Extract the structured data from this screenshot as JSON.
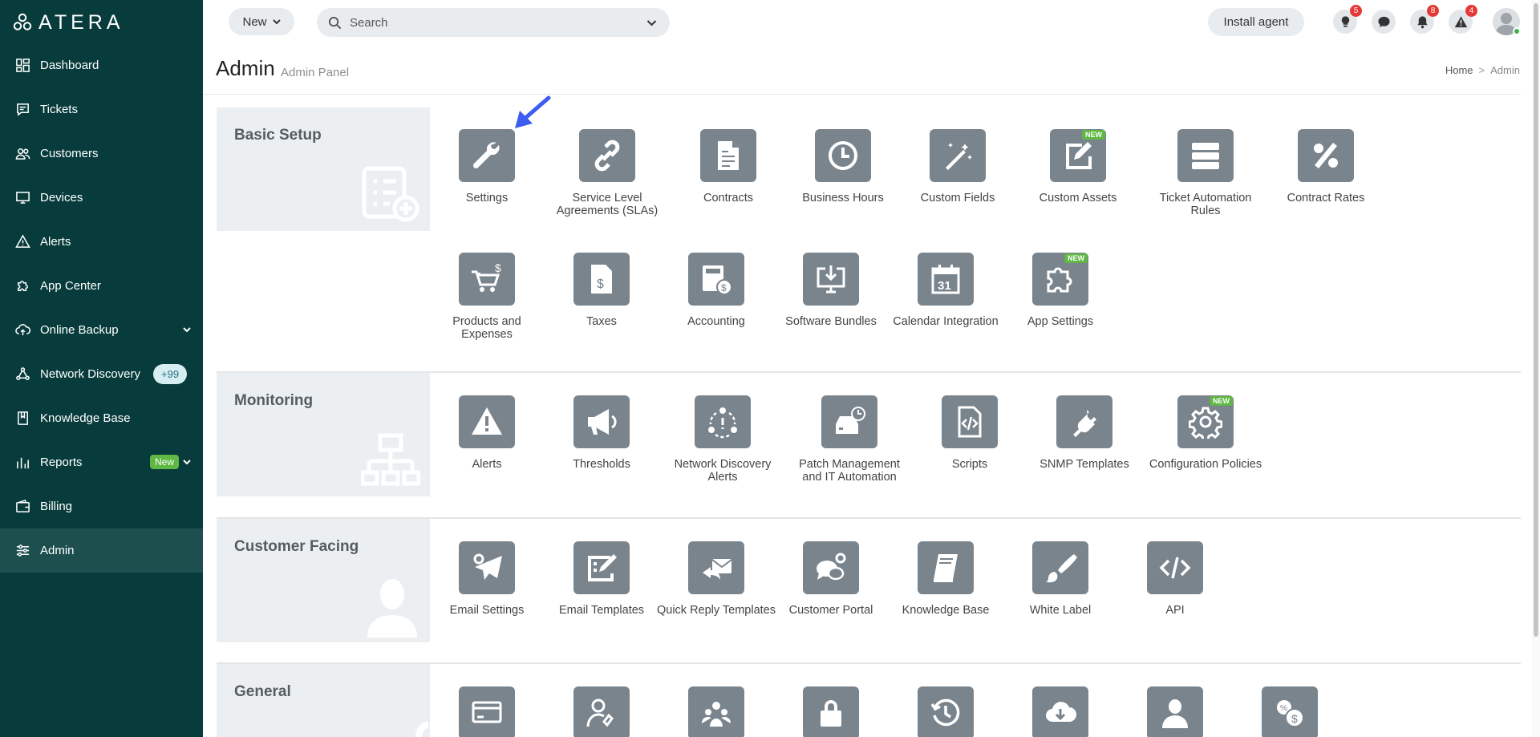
{
  "app": {
    "logo_text": "ATERA"
  },
  "sidebar": {
    "items": [
      {
        "label": "Dashboard",
        "icon": "dashboard-icon"
      },
      {
        "label": "Tickets",
        "icon": "ticket-icon"
      },
      {
        "label": "Customers",
        "icon": "customers-icon"
      },
      {
        "label": "Devices",
        "icon": "monitor-icon"
      },
      {
        "label": "Alerts",
        "icon": "alert-triangle-icon"
      },
      {
        "label": "App Center",
        "icon": "puzzle-icon"
      },
      {
        "label": "Online Backup",
        "icon": "cloud-upload-icon"
      },
      {
        "label": "Network Discovery",
        "icon": "network-icon",
        "count": "+99"
      },
      {
        "label": "Knowledge Base",
        "icon": "book-icon"
      },
      {
        "label": "Reports",
        "icon": "bar-chart-icon",
        "tag": "New"
      },
      {
        "label": "Billing",
        "icon": "wallet-icon"
      },
      {
        "label": "Admin",
        "icon": "sliders-icon",
        "active": true
      }
    ]
  },
  "topbar": {
    "new_label": "New",
    "search_placeholder": "Search",
    "install_label": "Install agent",
    "badges": {
      "tips": "5",
      "notifications": "8",
      "alerts": "4"
    }
  },
  "header": {
    "title": "Admin",
    "subtitle": "Admin Panel",
    "breadcrumb": {
      "home": "Home",
      "sep": ">",
      "current": "Admin"
    }
  },
  "sections": {
    "basic": {
      "title": "Basic Setup",
      "tiles": [
        {
          "label": "Settings"
        },
        {
          "label": "Service Level Agreements (SLAs)"
        },
        {
          "label": "Contracts"
        },
        {
          "label": "Business Hours"
        },
        {
          "label": "Custom Fields"
        },
        {
          "label": "Custom Assets",
          "tag": "NEW"
        },
        {
          "label": "Ticket Automation Rules"
        },
        {
          "label": "Contract Rates"
        },
        {
          "label": "Products and Expenses"
        },
        {
          "label": "Taxes"
        },
        {
          "label": "Accounting"
        },
        {
          "label": "Software Bundles"
        },
        {
          "label": "Calendar Integration"
        },
        {
          "label": "App Settings",
          "tag": "NEW"
        }
      ]
    },
    "monitoring": {
      "title": "Monitoring",
      "tiles": [
        {
          "label": "Alerts"
        },
        {
          "label": "Thresholds"
        },
        {
          "label": "Network Discovery Alerts"
        },
        {
          "label": "Patch Management and IT Automation"
        },
        {
          "label": "Scripts"
        },
        {
          "label": "SNMP Templates"
        },
        {
          "label": "Configuration Policies",
          "tag": "NEW"
        }
      ]
    },
    "customer": {
      "title": "Customer Facing",
      "tiles": [
        {
          "label": "Email Settings"
        },
        {
          "label": "Email Templates"
        },
        {
          "label": "Quick Reply Templates"
        },
        {
          "label": "Customer Portal"
        },
        {
          "label": "Knowledge Base"
        },
        {
          "label": "White Label"
        },
        {
          "label": "API"
        }
      ]
    },
    "general": {
      "title": "General"
    }
  }
}
